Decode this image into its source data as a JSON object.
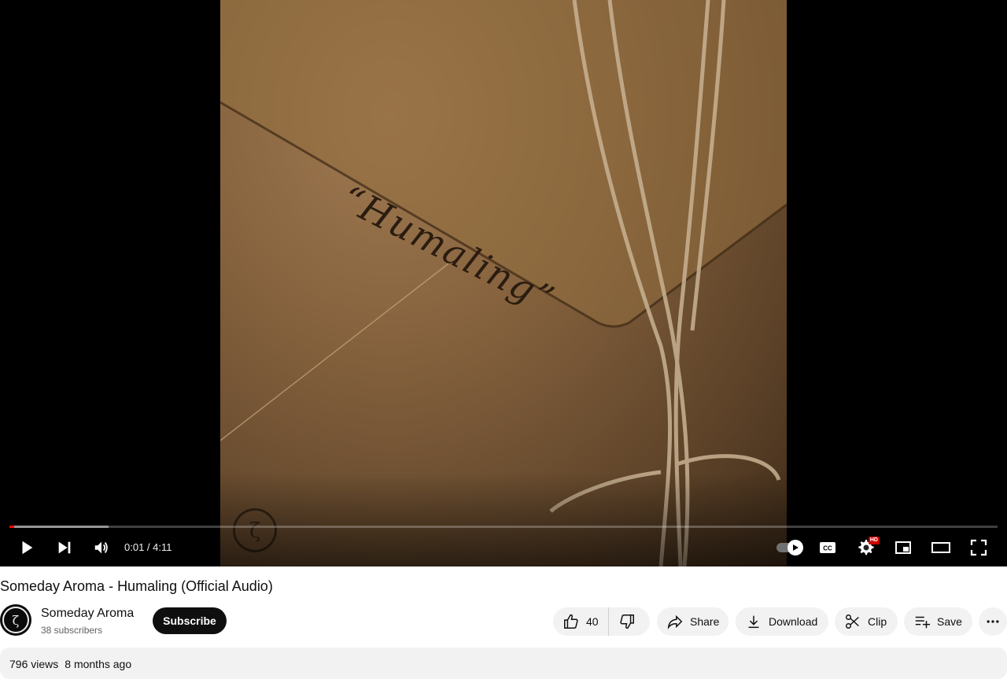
{
  "player": {
    "artwork_text": "“Humaling”",
    "artwork_logo": "ζ",
    "time_current": "0:01",
    "time_separator": " / ",
    "time_total": "4:11",
    "progress_played_fraction": 0.004,
    "progress_loaded_fraction": 0.1,
    "hd_badge": "HD",
    "icons": [
      "play-icon",
      "next-icon",
      "volume-icon",
      "autoplay-toggle-icon",
      "captions-icon",
      "settings-icon",
      "miniplayer-icon",
      "theater-icon",
      "fullscreen-icon"
    ],
    "progress_color": "#ff0000"
  },
  "video": {
    "title": "Someday Aroma - Humaling (Official Audio)"
  },
  "channel": {
    "name": "Someday Aroma",
    "subscribers": "38 subscribers",
    "avatar_glyph": "ζ",
    "subscribe_label": "Subscribe"
  },
  "actions": {
    "like_count": "40",
    "share_label": "Share",
    "download_label": "Download",
    "clip_label": "Clip",
    "save_label": "Save"
  },
  "description": {
    "views": "796 views",
    "posted": "8 months ago"
  }
}
